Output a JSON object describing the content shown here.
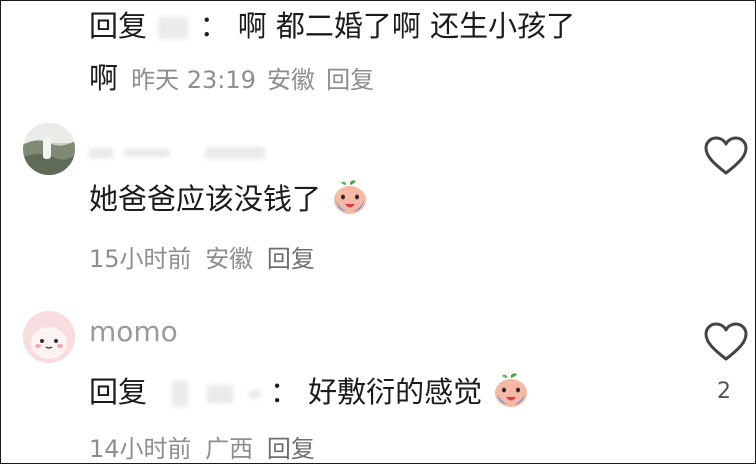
{
  "comments": [
    {
      "reply_prefix": "回复",
      "reply_colon": "：",
      "text_line1": "啊 都二婚了啊 还生小孩了",
      "text_line2": "啊",
      "time": "昨天 23:19",
      "location": "安徽",
      "reply_label": "回复"
    },
    {
      "username": "",
      "text": "她爸爸应该没钱了",
      "emoji": "crying-peach-emoji",
      "time": "15小时前",
      "location": "安徽",
      "reply_label": "回复"
    },
    {
      "username": "momo",
      "reply_prefix": "回复",
      "reply_colon": "：",
      "text": "好敷衍的感觉",
      "emoji": "crying-peach-emoji",
      "time": "14小时前",
      "location": "广西",
      "reply_label": "回复",
      "like_count": "2"
    }
  ],
  "icons": {
    "like": "heart-outline-icon"
  },
  "colors": {
    "meta_gray": "#8e8e8e",
    "text": "#1b1b1b",
    "pink_avatar": "#f6d3d6"
  }
}
